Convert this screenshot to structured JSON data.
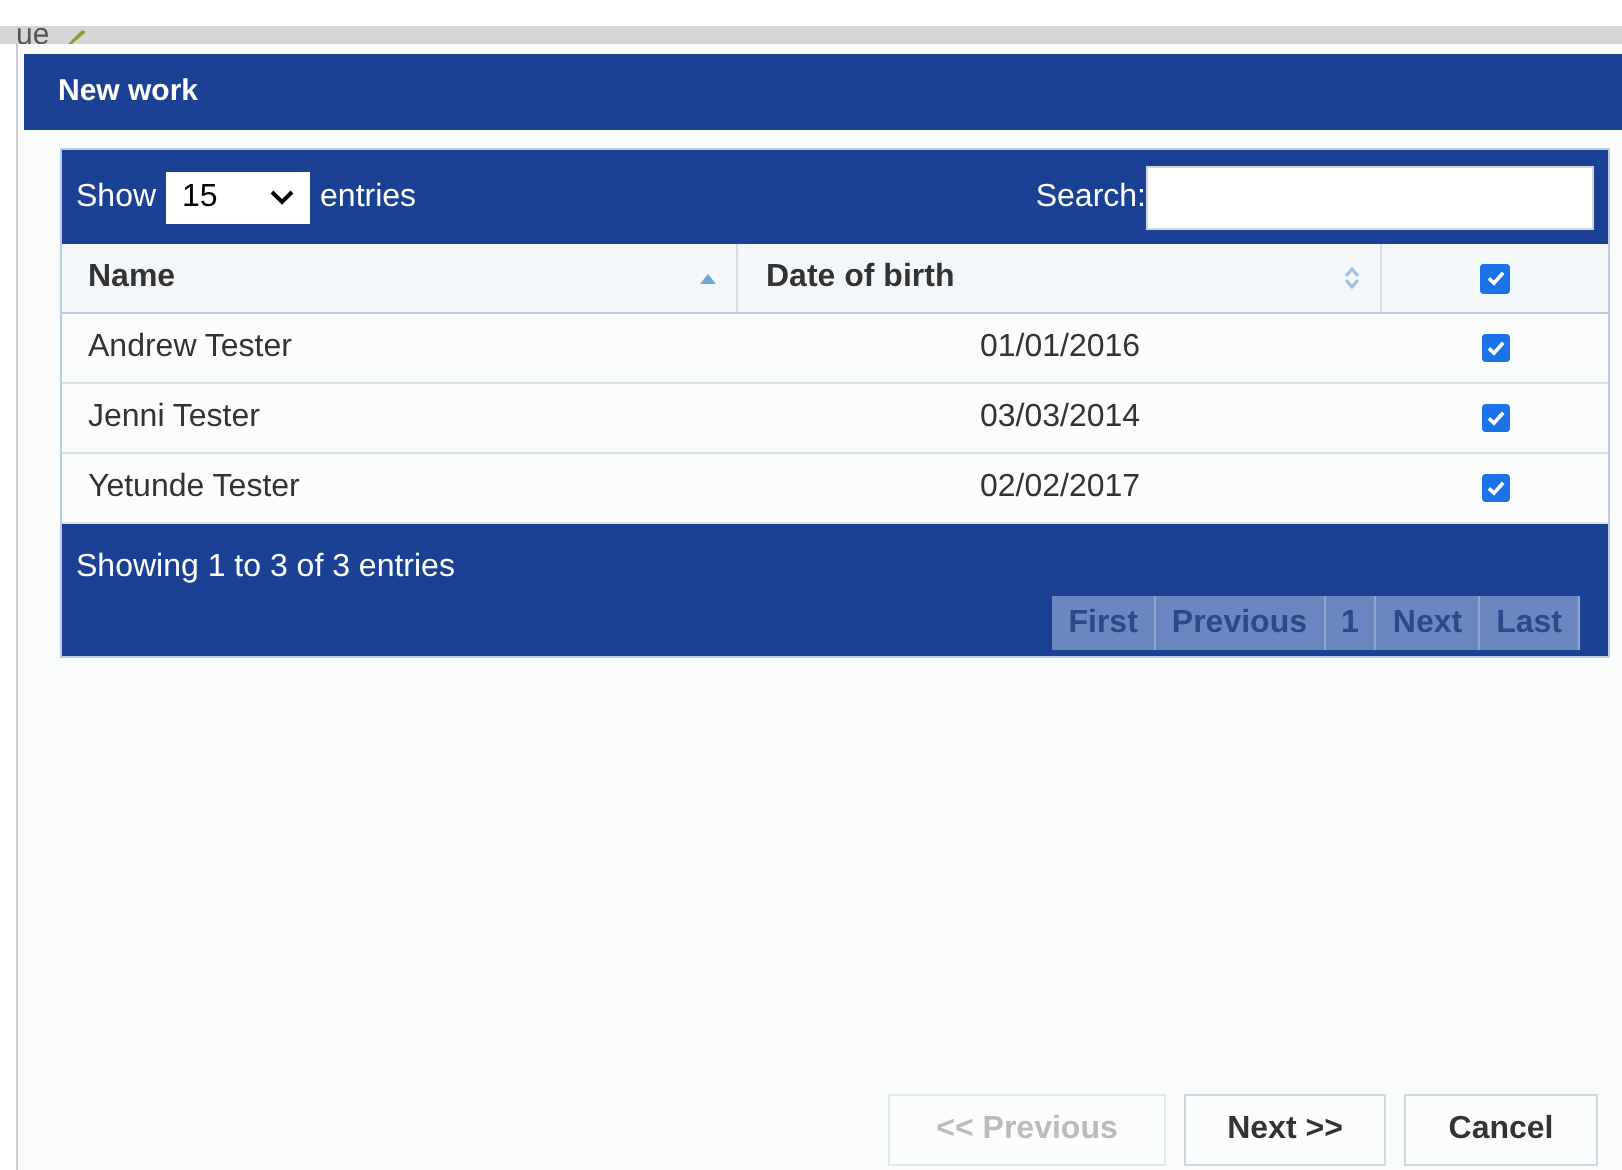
{
  "background_text": "ue",
  "dialog": {
    "title": "New work"
  },
  "table": {
    "length_label_before": "Show",
    "length_value": "15",
    "length_label_after": "entries",
    "search_label": "Search:",
    "columns": [
      {
        "label": "Name",
        "sorted": true
      },
      {
        "label": "Date of birth",
        "sorted": false
      },
      {
        "kind": "checkbox",
        "checked": true
      }
    ],
    "rows": [
      {
        "name": "Andrew Tester",
        "date_of_birth": "01/01/2016",
        "checked": true
      },
      {
        "name": "Jenni Tester",
        "date_of_birth": "03/03/2014",
        "checked": true
      },
      {
        "name": "Yetunde Tester",
        "date_of_birth": "02/02/2017",
        "checked": true
      }
    ],
    "info": "Showing 1 to 3 of 3 entries",
    "pagination": [
      {
        "label": "First",
        "disabled": true
      },
      {
        "label": "Previous",
        "disabled": true
      },
      {
        "label": "1",
        "disabled": true
      },
      {
        "label": "Next",
        "disabled": true
      },
      {
        "label": "Last",
        "disabled": true
      }
    ]
  },
  "buttons": [
    {
      "label": "<< Previous",
      "disabled": true
    },
    {
      "label": "Next >>",
      "disabled": false
    },
    {
      "label": "Cancel",
      "disabled": false
    }
  ]
}
